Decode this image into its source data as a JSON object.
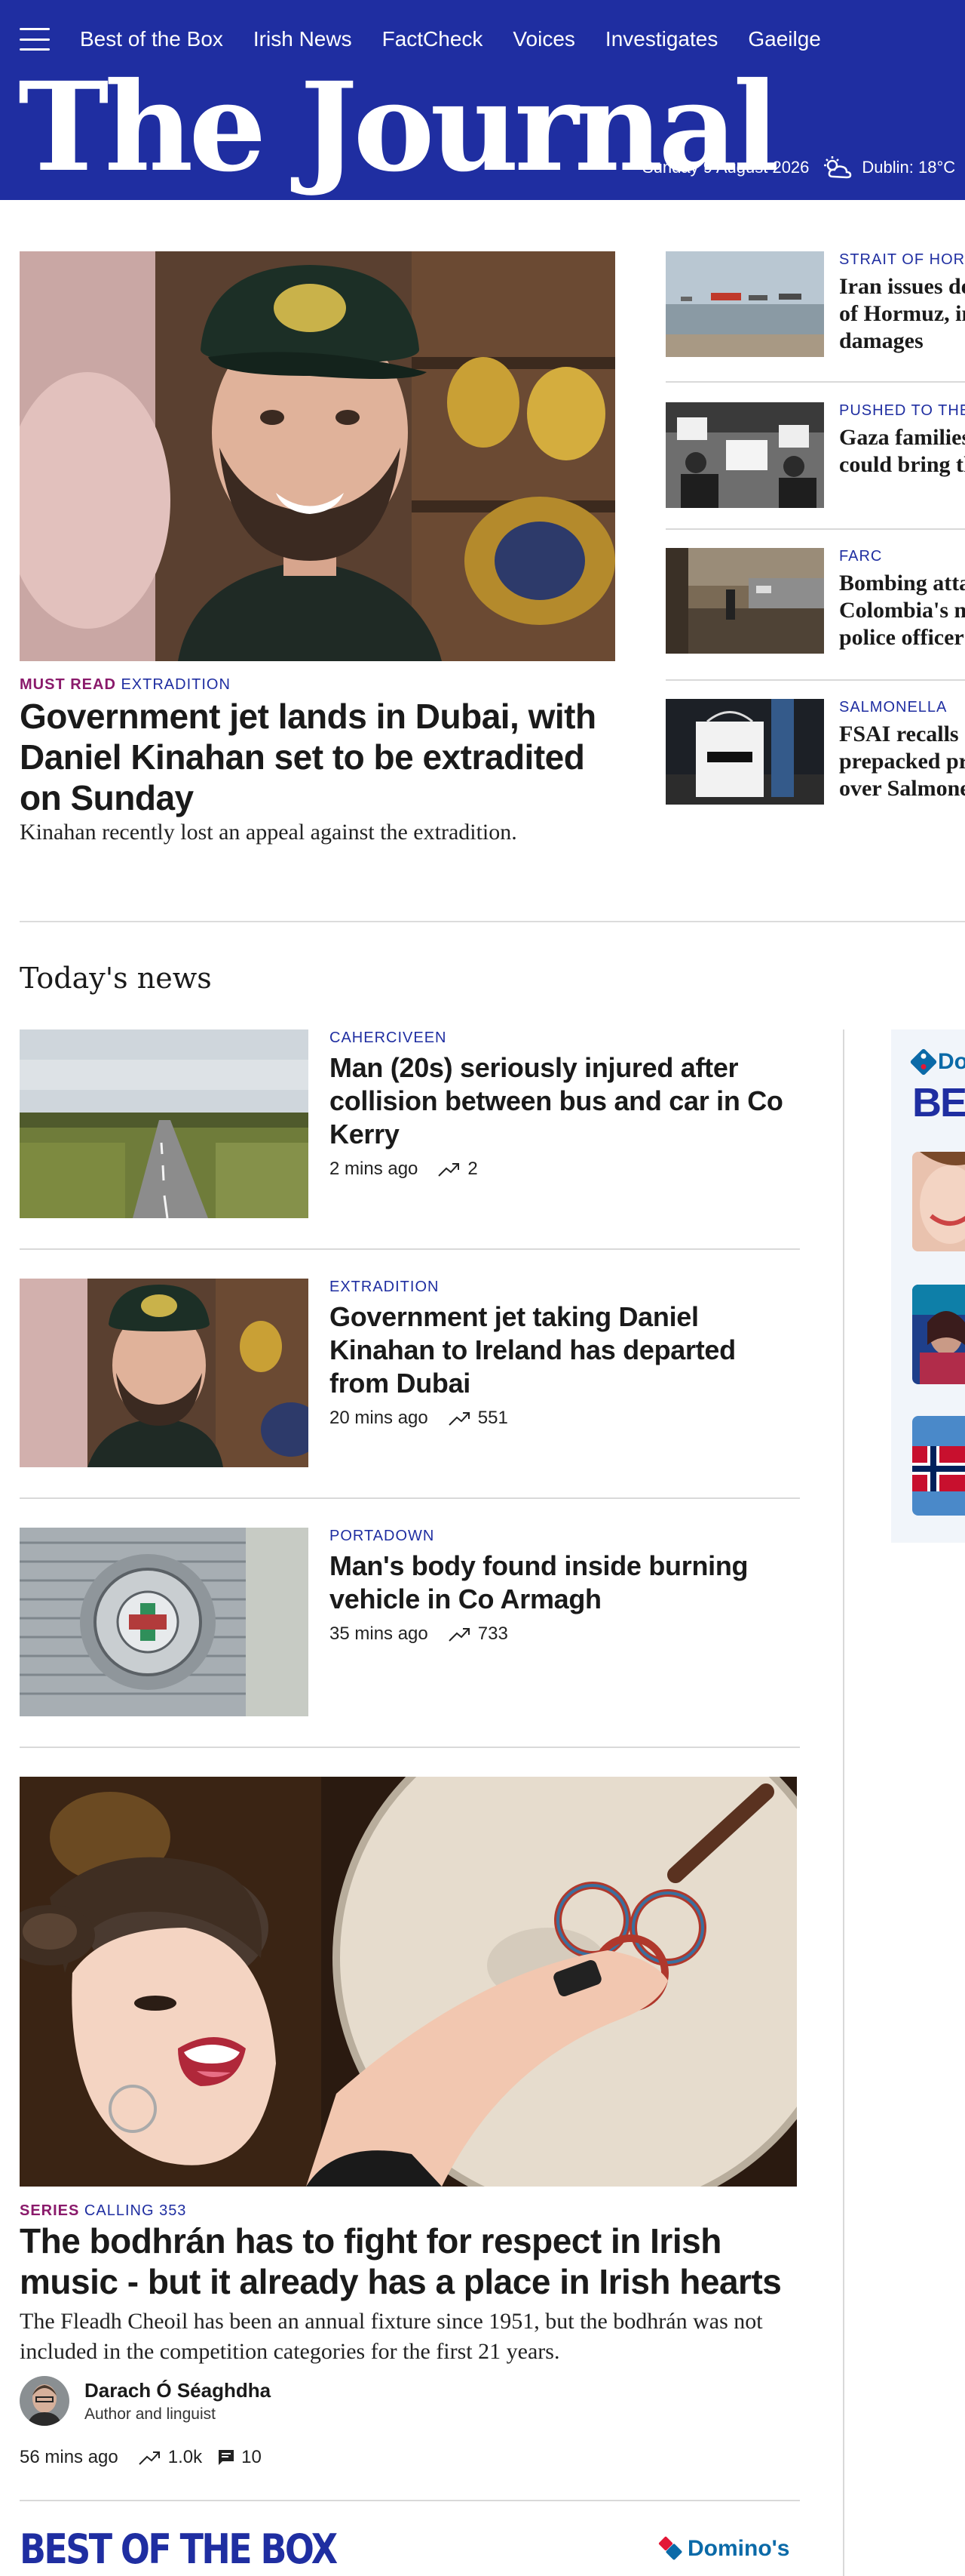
{
  "header": {
    "nav": [
      "Best of the Box",
      "Irish News",
      "FactCheck",
      "Voices",
      "Investigates",
      "Gaeilge"
    ],
    "logo": "The Journal",
    "date": "Sunday 9 August 2026",
    "weather": "Dublin: 18°C",
    "weather_icon": "partly-cloudy-icon"
  },
  "hero": {
    "kicker_mustread": "MUST READ",
    "kicker_category": "EXTRADITION",
    "title": "Government jet lands in Dubai, with Daniel Kinahan set to be extradited on Sunday",
    "subtitle": "Kinahan recently lost an appeal against the extradition."
  },
  "side_stories": [
    {
      "kicker": "STRAIT OF HORM",
      "title": [
        "Iran issues de",
        "of Hormuz, in",
        "damages"
      ]
    },
    {
      "kicker": "PUSHED TO THE",
      "title": [
        "Gaza families",
        "could bring th"
      ]
    },
    {
      "kicker": "FARC",
      "title": [
        "Bombing atta",
        "Colombia's n",
        "police officer"
      ]
    },
    {
      "kicker": "SALMONELLA",
      "title": [
        "FSAI recalls o",
        "prepacked pr",
        "over Salmone"
      ]
    }
  ],
  "section": {
    "title": "Today's news"
  },
  "news": [
    {
      "kicker": "CAHERCIVEEN",
      "title": "Man (20s) seriously injured after collision between bus and car in Co Kerry",
      "time": "2 mins ago",
      "trend": "2"
    },
    {
      "kicker": "EXTRADITION",
      "title": "Government jet taking Daniel Kinahan to Ireland has departed from Dubai",
      "time": "20 mins ago",
      "trend": "551"
    },
    {
      "kicker": "PORTADOWN",
      "title": "Man's body found inside burning vehicle in Co Armagh",
      "time": "35 mins ago",
      "trend": "733"
    }
  ],
  "feature": {
    "kicker_series": "SERIES",
    "kicker_category": "CALLING 353",
    "title": "The bodhrán has to fight for respect in Irish music - but it already has a place in Irish hearts",
    "subtitle": "The Fleadh Cheoil has been an annual fixture since 1951, but the bodhrán was not included in the competition categories for the first 21 years.",
    "author_name": "Darach Ó Séaghdha",
    "author_role": "Author and linguist",
    "time": "56 mins ago",
    "trend": "1.0k",
    "comments": "10"
  },
  "ad": {
    "brand_partial": "Do",
    "headline_partial": "BES"
  },
  "footer_promo": {
    "title": "BEST OF THE BOX",
    "sponsor": "Domino's"
  },
  "colors": {
    "brand_blue": "#1f2ea1",
    "must_read": "#8a1a6b",
    "dominos_blue": "#0b6aa8",
    "dominos_red": "#e31837"
  }
}
